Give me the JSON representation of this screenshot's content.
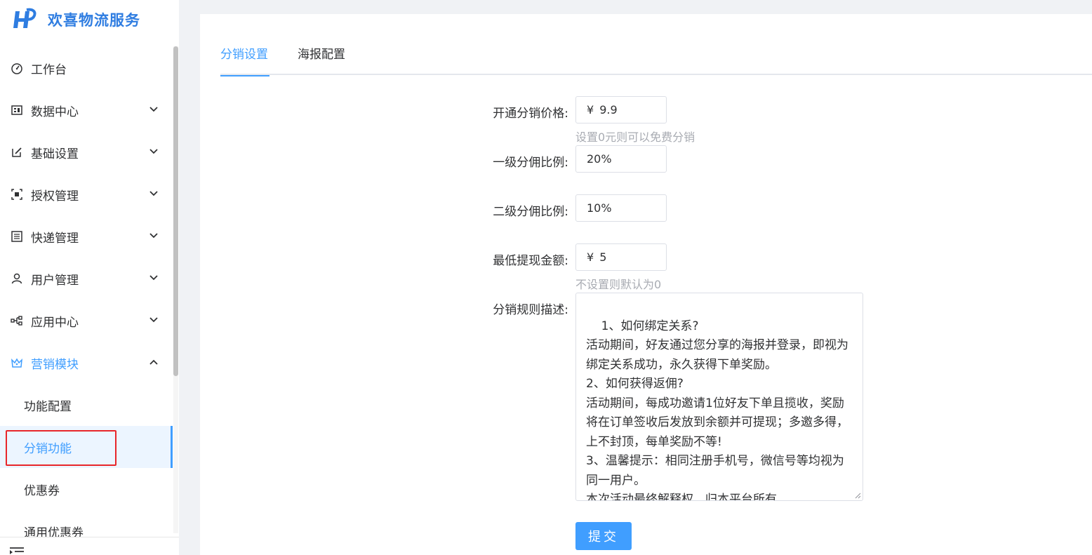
{
  "app": {
    "title": "欢喜物流服务"
  },
  "sidebar": {
    "items": [
      {
        "label": "工作台",
        "icon": "dashboard-icon"
      },
      {
        "label": "数据中心",
        "icon": "data-icon"
      },
      {
        "label": "基础设置",
        "icon": "edit-icon"
      },
      {
        "label": "授权管理",
        "icon": "scan-icon"
      },
      {
        "label": "快递管理",
        "icon": "list-icon"
      },
      {
        "label": "用户管理",
        "icon": "user-icon"
      },
      {
        "label": "应用中心",
        "icon": "apps-icon"
      },
      {
        "label": "营销模块",
        "icon": "crown-icon"
      }
    ],
    "sub_items": [
      {
        "label": "功能配置"
      },
      {
        "label": "分销功能"
      },
      {
        "label": "优惠券"
      },
      {
        "label": "通用优惠券"
      }
    ]
  },
  "tabs": [
    {
      "label": "分销设置"
    },
    {
      "label": "海报配置"
    }
  ],
  "form": {
    "price_label": "开通分销价格:",
    "price_prefix": "¥",
    "price_value": "9.9",
    "price_hint": "设置0元则可以免费分销",
    "level1_label": "一级分佣比例:",
    "level1_value": "20%",
    "level2_label": "二级分佣比例:",
    "level2_value": "10%",
    "min_withdraw_label": "最低提现金额:",
    "min_withdraw_prefix": "¥",
    "min_withdraw_value": "5",
    "min_withdraw_hint": "不设置则默认为0",
    "rules_label": "分销规则描述:",
    "rules_value": "1、如何绑定关系?\n活动期间，好友通过您分享的海报并登录，即视为绑定关系成功，永久获得下单奖励。\n2、如何获得返佣?\n活动期间，每成功邀请1位好友下单且揽收，奖励将在订单签收后发放到余额并可提现；多邀多得，上不封顶，每单奖励不等!\n3、温馨提示：相同注册手机号，微信号等均视为同一用户。\n本次活动最终解释权，归本平台所有。",
    "submit_label": "提交"
  },
  "colors": {
    "primary": "#409eff",
    "brand": "#2f7de1",
    "highlight": "#e8262a"
  }
}
